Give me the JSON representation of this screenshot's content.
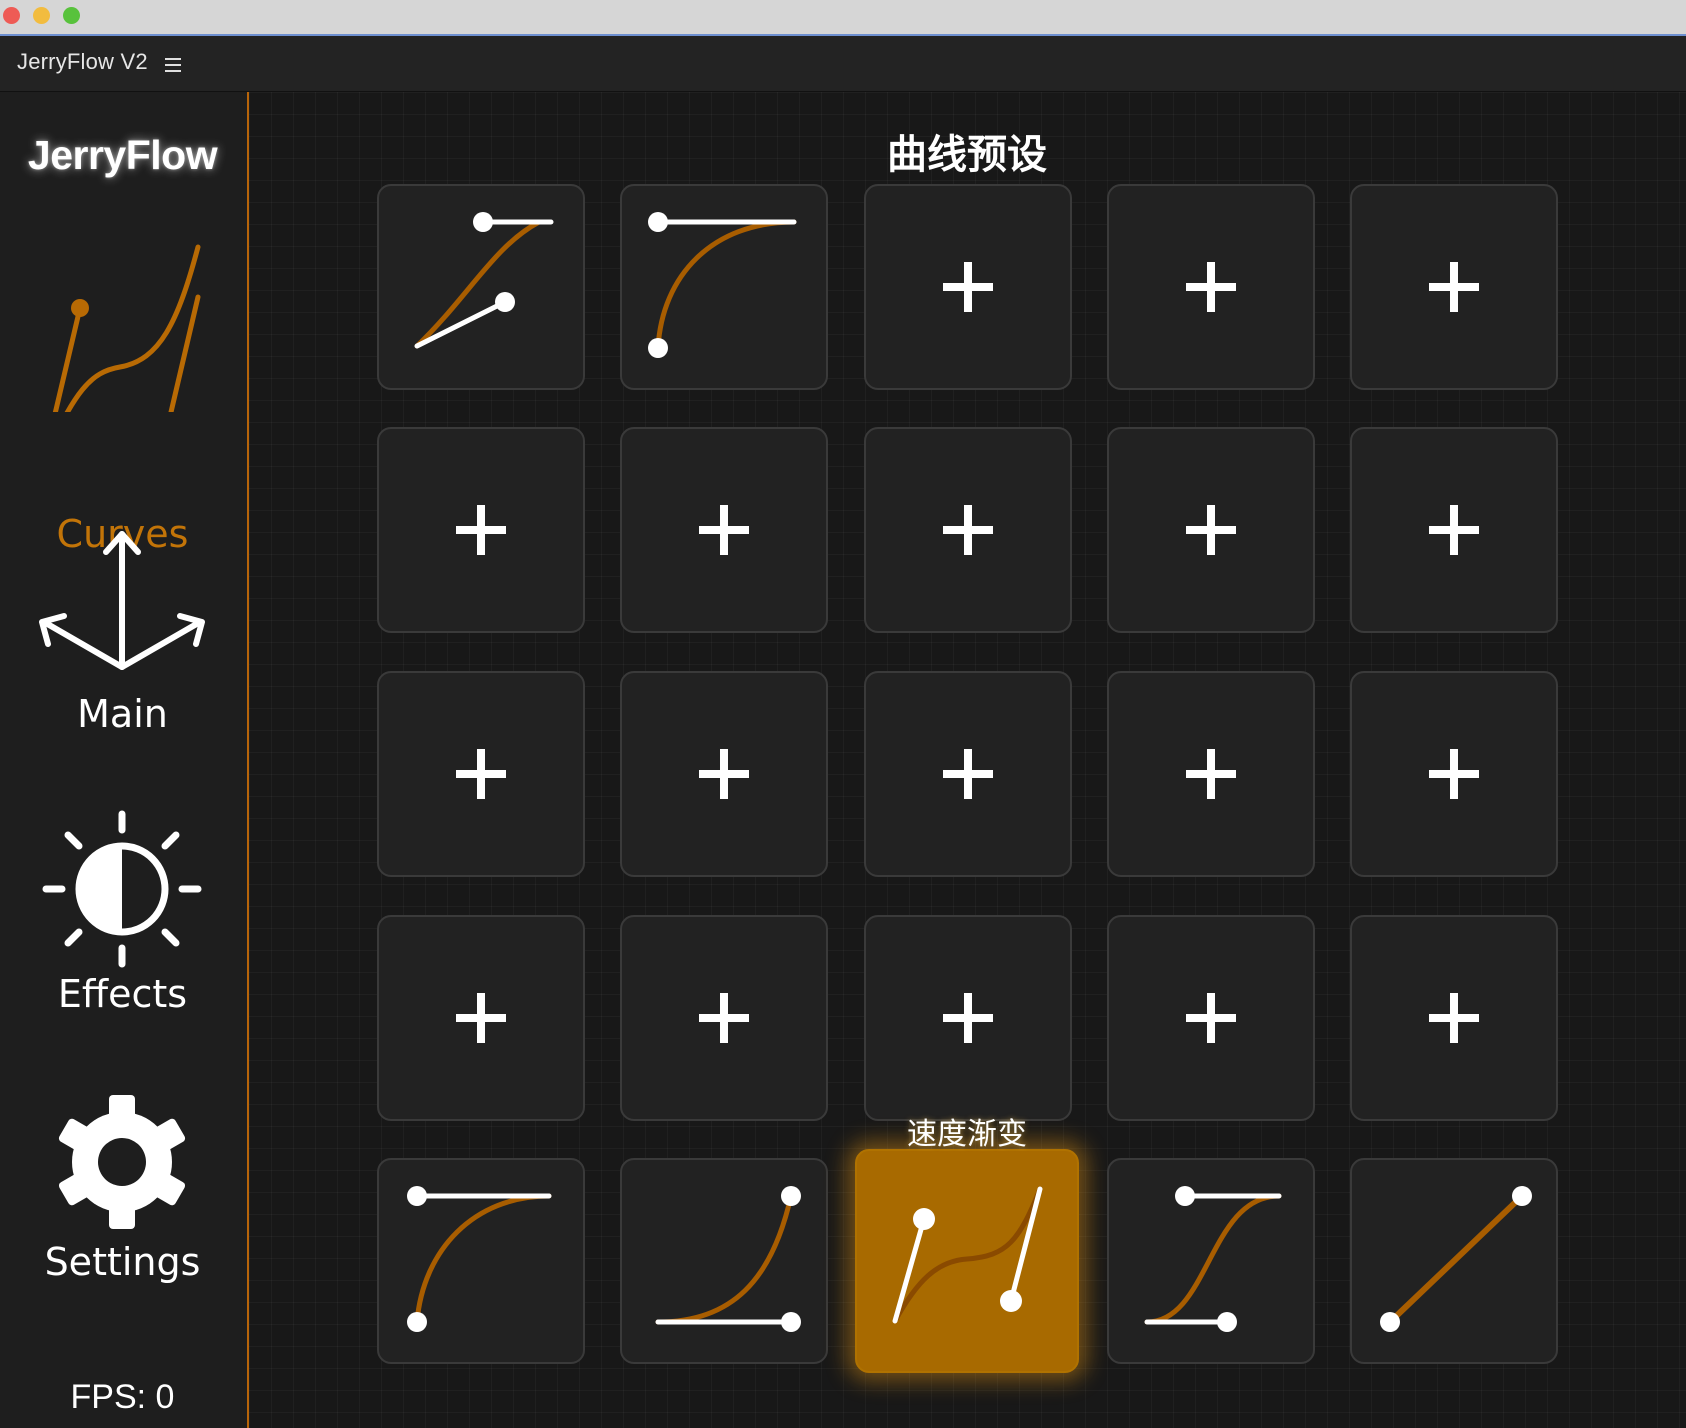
{
  "app": {
    "title": "JerryFlow V2",
    "brand": "JerryFlow"
  },
  "sidebar": {
    "items": [
      {
        "label": "Curves",
        "icon": "curves-icon",
        "active": true
      },
      {
        "label": "Main",
        "icon": "axes-arrows-icon",
        "active": false
      },
      {
        "label": "Effects",
        "icon": "brightness-icon",
        "active": false
      },
      {
        "label": "Settings",
        "icon": "gear-icon",
        "active": false
      }
    ],
    "fps": "FPS: 0"
  },
  "main": {
    "title": "曲线预设",
    "hovered_tile_label": "速度渐变",
    "grid": {
      "rows": 5,
      "cols": 5,
      "tiles": [
        {
          "row": 1,
          "col": 1,
          "content": "s-curve-preset-icon"
        },
        {
          "row": 1,
          "col": 2,
          "content": "ease-out-preset-icon"
        },
        {
          "row": 1,
          "col": 3,
          "content": "plus-icon"
        },
        {
          "row": 1,
          "col": 4,
          "content": "plus-icon"
        },
        {
          "row": 1,
          "col": 5,
          "content": "plus-icon"
        },
        {
          "row": 2,
          "col": 1,
          "content": "plus-icon"
        },
        {
          "row": 2,
          "col": 2,
          "content": "plus-icon"
        },
        {
          "row": 2,
          "col": 3,
          "content": "plus-icon"
        },
        {
          "row": 2,
          "col": 4,
          "content": "plus-icon"
        },
        {
          "row": 2,
          "col": 5,
          "content": "plus-icon"
        },
        {
          "row": 3,
          "col": 1,
          "content": "plus-icon"
        },
        {
          "row": 3,
          "col": 2,
          "content": "plus-icon"
        },
        {
          "row": 3,
          "col": 3,
          "content": "plus-icon"
        },
        {
          "row": 3,
          "col": 4,
          "content": "plus-icon"
        },
        {
          "row": 3,
          "col": 5,
          "content": "plus-icon"
        },
        {
          "row": 4,
          "col": 1,
          "content": "plus-icon"
        },
        {
          "row": 4,
          "col": 2,
          "content": "plus-icon"
        },
        {
          "row": 4,
          "col": 3,
          "content": "plus-icon"
        },
        {
          "row": 4,
          "col": 4,
          "content": "plus-icon"
        },
        {
          "row": 4,
          "col": 5,
          "content": "plus-icon"
        },
        {
          "row": 5,
          "col": 1,
          "content": "ease-out-preset-icon"
        },
        {
          "row": 5,
          "col": 2,
          "content": "ease-in-preset-icon"
        },
        {
          "row": 5,
          "col": 3,
          "content": "speed-ramp-preset-icon",
          "highlighted": true
        },
        {
          "row": 5,
          "col": 4,
          "content": "ease-in-out-preset-icon"
        },
        {
          "row": 5,
          "col": 5,
          "content": "linear-preset-icon"
        }
      ]
    }
  },
  "colors": {
    "accent": "#c27408",
    "curve": "#a85d00",
    "handle": "#ffffff",
    "tile_bg": "#222222",
    "tile_highlight": "#a86a00",
    "sidebar_border": "#b8650a"
  }
}
